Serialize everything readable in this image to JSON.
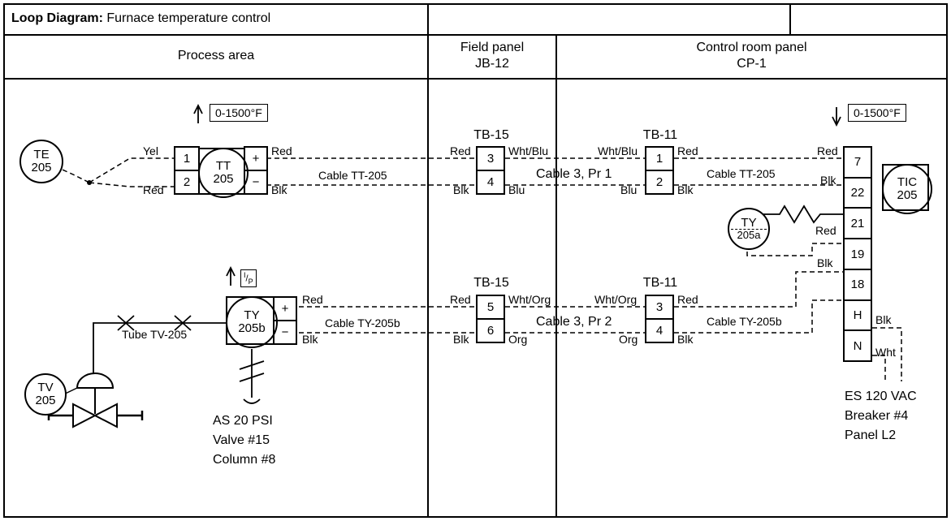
{
  "title_label": "Loop Diagram:",
  "title_value": "Furnace temperature control",
  "areas": {
    "process": "Process area",
    "field_panel_l1": "Field panel",
    "field_panel_l2": "JB-12",
    "control_room_l1": "Control room panel",
    "control_room_l2": "CP-1"
  },
  "range_process": "0-1500°F",
  "range_control": "0-1500°F",
  "ip_label": "I/P",
  "instruments": {
    "TE": {
      "tag": "TE",
      "num": "205"
    },
    "TT": {
      "tag": "TT",
      "num": "205"
    },
    "TY205b": {
      "tag": "TY",
      "num": "205b"
    },
    "TY205a": {
      "tag": "TY",
      "num": "205a"
    },
    "TIC": {
      "tag": "TIC",
      "num": "205"
    },
    "TV": {
      "tag": "TV",
      "num": "205"
    }
  },
  "tb_labels": {
    "tb15_top": "TB-15",
    "tb11_top": "TB-11",
    "tb15_bot": "TB-15",
    "tb11_bot": "TB-11"
  },
  "terminals": {
    "tt_left": [
      "1",
      "2"
    ],
    "tt_right": [
      "+",
      "−"
    ],
    "ty_right": [
      "+",
      "−"
    ],
    "tb15_top": [
      "3",
      "4"
    ],
    "tb11_top": [
      "1",
      "2"
    ],
    "tb15_bot": [
      "5",
      "6"
    ],
    "tb11_bot": [
      "3",
      "4"
    ],
    "tic_stack": [
      "7",
      "22",
      "21",
      "19",
      "18",
      "H",
      "N"
    ]
  },
  "wire_colors": {
    "yel": "Yel",
    "red": "Red",
    "blk": "Blk",
    "blu": "Blu",
    "whtblu": "Wht/Blu",
    "whtorg": "Wht/Org",
    "org": "Org",
    "wht": "Wht"
  },
  "cables": {
    "tt205": "Cable TT-205",
    "c3p1": "Cable 3, Pr 1",
    "ty205b": "Cable TY-205b",
    "c3p2": "Cable 3, Pr 2"
  },
  "tube": "Tube TV-205",
  "air_supply": {
    "l1": "AS 20 PSI",
    "l2": "Valve #15",
    "l3": "Column #8"
  },
  "power": {
    "l1": "ES 120 VAC",
    "l2": "Breaker #4",
    "l3": "Panel L2"
  }
}
